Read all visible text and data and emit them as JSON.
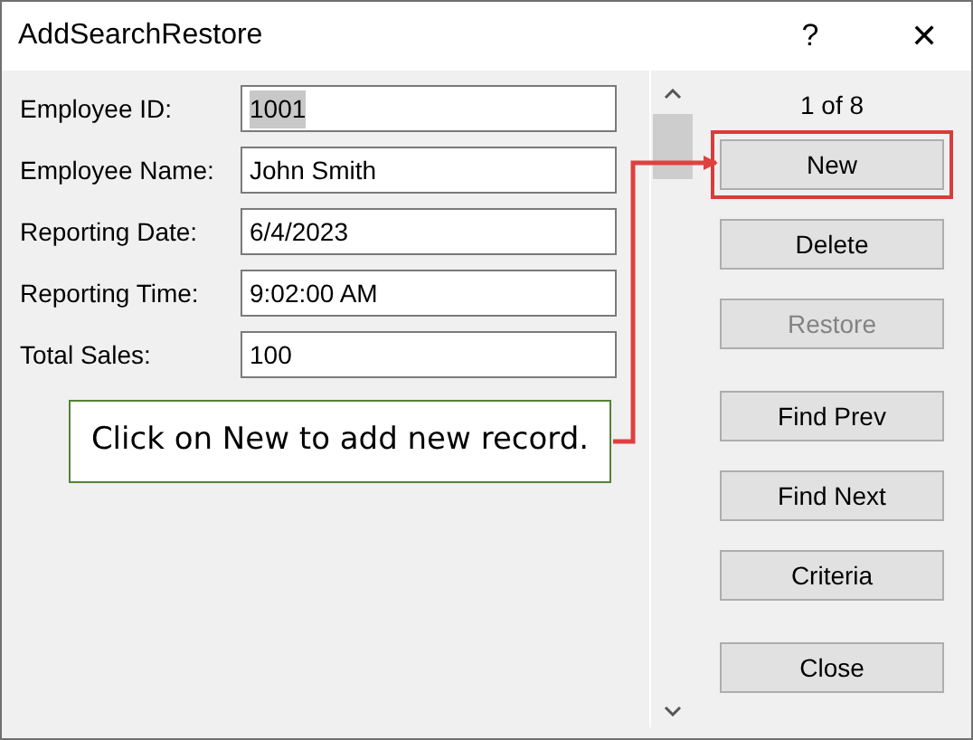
{
  "window": {
    "title": "AddSearchRestore",
    "help": "?",
    "close": "✕"
  },
  "fields": [
    {
      "label": "Employee ID:",
      "value": "1001",
      "highlighted": true
    },
    {
      "label": "Employee Name:",
      "value": "John Smith",
      "highlighted": false
    },
    {
      "label": "Reporting Date:",
      "value": "6/4/2023",
      "highlighted": false
    },
    {
      "label": "Reporting Time:",
      "value": "9:02:00 AM",
      "highlighted": false
    },
    {
      "label": "Total Sales:",
      "value": "100",
      "highlighted": false
    }
  ],
  "record_counter": "1 of 8",
  "buttons": [
    {
      "label": "New",
      "disabled": false,
      "outlined": true
    },
    {
      "label": "Delete",
      "disabled": false,
      "outlined": false
    },
    {
      "label": "Restore",
      "disabled": true,
      "outlined": false
    },
    {
      "label": "Find Prev",
      "disabled": false,
      "outlined": false
    },
    {
      "label": "Find Next",
      "disabled": false,
      "outlined": false
    },
    {
      "label": "Criteria",
      "disabled": false,
      "outlined": false
    },
    {
      "label": "Close",
      "disabled": false,
      "outlined": false
    }
  ],
  "callout": {
    "text": "Click on New to add new record."
  }
}
